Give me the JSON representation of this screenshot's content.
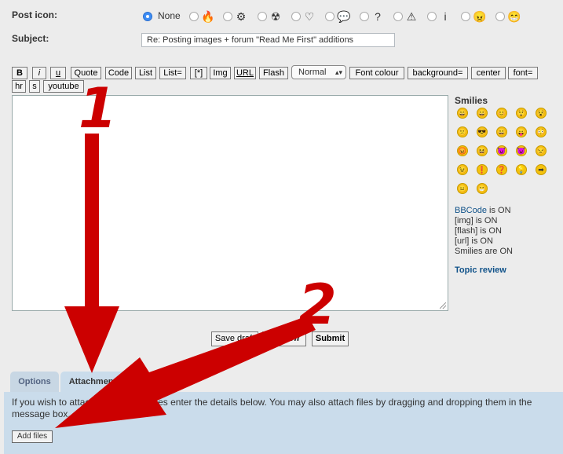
{
  "form": {
    "post_icon_label": "Post icon:",
    "none_label": "None",
    "subject_label": "Subject:",
    "subject_value": "Re: Posting images +  forum \"Read Me First\" additions"
  },
  "post_icons": [
    {
      "name": "fire-icon",
      "glyph": "🔥"
    },
    {
      "name": "gear-icon",
      "glyph": "⚙"
    },
    {
      "name": "radioactive-icon",
      "glyph": "☢"
    },
    {
      "name": "heart-icon",
      "glyph": "♡"
    },
    {
      "name": "speech-bubble-icon",
      "glyph": "💬"
    },
    {
      "name": "question-icon",
      "glyph": "?"
    },
    {
      "name": "warning-icon",
      "glyph": "⚠"
    },
    {
      "name": "info-icon",
      "glyph": "i"
    },
    {
      "name": "mad-face-icon",
      "glyph": "😠"
    },
    {
      "name": "grin-face-icon",
      "glyph": "😁"
    }
  ],
  "toolbar": {
    "b": "B",
    "i": "i",
    "u": "u",
    "quote": "Quote",
    "code": "Code",
    "list": "List",
    "list_eq": "List=",
    "star": "[*]",
    "img": "Img",
    "url": "URL",
    "flash": "Flash",
    "size_select": "Normal",
    "font_colour": "Font colour",
    "background": "background=",
    "center": "center",
    "font": "font=",
    "hr": "hr",
    "s": "s",
    "youtube": "youtube"
  },
  "sidebar": {
    "smilies_title": "Smilies",
    "bbcode_label": "BBCode",
    "bbcode_state": "is ON",
    "img_label": "[img]",
    "img_state": "is ON",
    "flash_label": "[flash]",
    "flash_state": "is ON",
    "url_label": "[url]",
    "url_state": "is ON",
    "smilies_label": "Smilies",
    "smilies_state": "are ON",
    "topic_review": "Topic review"
  },
  "smilies": [
    "😄",
    "😀",
    "😊",
    "😲",
    "😵",
    "😕",
    "😎",
    "😄",
    "😛",
    "😳",
    "😡",
    "😆",
    "😈",
    "😈",
    "😒",
    "😉",
    "❗",
    "❓",
    "💡",
    "➡",
    "😐",
    "😁"
  ],
  "actions": {
    "save_draft": "Save draft",
    "preview": "Preview",
    "submit": "Submit"
  },
  "tabs": {
    "options": "Options",
    "attachments": "Attachments"
  },
  "attachments": {
    "info": "If you wish to attach one or more files enter the details below. You may also attach files by dragging and dropping them in the message box.",
    "add_files": "Add files"
  },
  "annotations": {
    "one": "1",
    "two": "2",
    "arrow_color": "#cc0000"
  }
}
